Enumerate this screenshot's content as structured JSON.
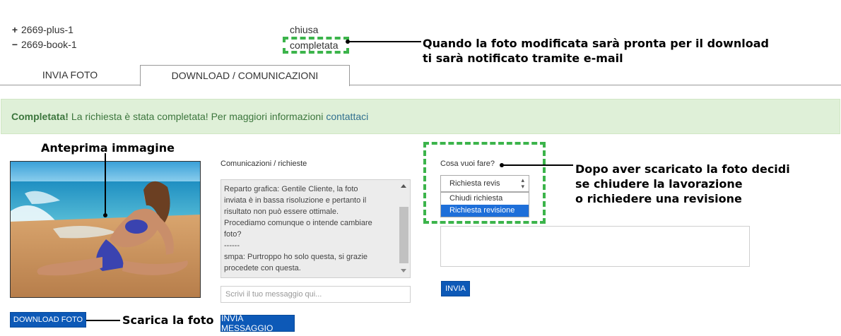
{
  "orders": {
    "plus": {
      "symbol": "+",
      "label": "2669-plus-1"
    },
    "book": {
      "symbol": "−",
      "label": "2669-book-1"
    }
  },
  "statuses": {
    "closed": "chiusa",
    "completed": "completata"
  },
  "callouts": {
    "top": [
      "Quando la foto modificata sarà pronta per il download",
      "ti sarà notificato tramite e-mail"
    ],
    "preview": "Anteprima immagine",
    "decide": [
      "Dopo aver scaricato la foto decidi",
      "se chiudere la lavorazione",
      "o richiedere una revisione"
    ],
    "download": "Scarica la foto"
  },
  "tabs": [
    {
      "label": "INVIA FOTO",
      "active": false
    },
    {
      "label": "DOWNLOAD / COMUNICAZIONI",
      "active": true
    }
  ],
  "alert": {
    "strong": "Completata!",
    "text": "La richiesta è stata completata! Per maggiori informazioni",
    "link": "contattaci"
  },
  "communications": {
    "label": "Comunicazioni / richieste",
    "messages": [
      "Reparto grafica: Gentile Cliente, la foto",
      "inviata è in bassa risoluzione e pertanto il",
      "risultato non può essere ottimale.",
      "Procediamo comunque o intende cambiare",
      "foto?",
      "------",
      "smpa: Purtroppo ho solo questa, si grazie",
      "procedete con questa."
    ],
    "input_placeholder": "Scrivi il tuo messaggio qui...",
    "send_label": "INVIA MESSAGGIO"
  },
  "action": {
    "label": "Cosa vuoi fare?",
    "selected": "Richiesta revis",
    "options": [
      "Chiudi richiesta",
      "Richiesta revisione"
    ],
    "highlighted": 1,
    "send_label": "INVIA"
  },
  "download_label": "DOWNLOAD FOTO",
  "colors": {
    "accent": "#0d59b7",
    "dash": "#3cb44b",
    "alert_bg": "#dff0d8",
    "alert_text": "#3c763d"
  }
}
